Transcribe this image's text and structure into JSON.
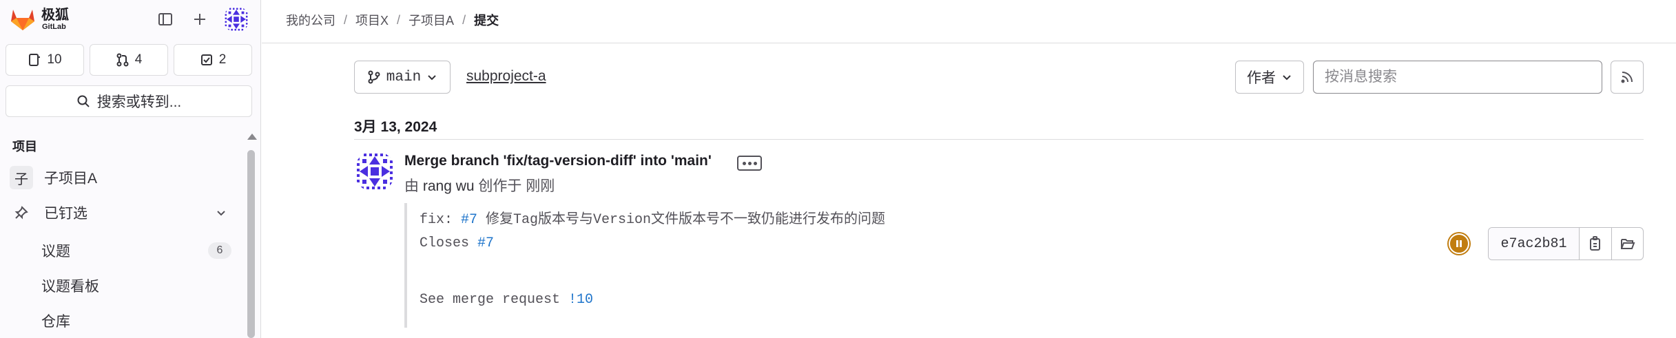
{
  "sidebar": {
    "brand_cn": "极狐",
    "brand_en": "GitLab",
    "counts": [
      {
        "icon": "issues-icon",
        "value": "10"
      },
      {
        "icon": "merge-request-icon",
        "value": "4"
      },
      {
        "icon": "todo-icon",
        "value": "2"
      }
    ],
    "search_label": "搜索或转到...",
    "section_label": "项目",
    "project_badge": "子",
    "project_name": "子项目A",
    "pinned_label": "已钉选",
    "items": [
      {
        "label": "议题",
        "count": "6"
      },
      {
        "label": "议题看板"
      },
      {
        "label": "仓库"
      }
    ]
  },
  "breadcrumb": [
    "我的公司",
    "项目X",
    "子项目A",
    "提交"
  ],
  "toolbar": {
    "branch": "main",
    "path": "subproject-a",
    "author_label": "作者",
    "search_placeholder": "按消息搜索"
  },
  "date_header": "3月 13, 2024",
  "commit": {
    "title": "Merge branch 'fix/tag-version-diff' into 'main'",
    "meta_prefix": "由",
    "author": "rang wu",
    "meta_action": "创作于",
    "time": "刚刚",
    "desc_line1_prefix": "fix: ",
    "desc_line1_ref": "#7",
    "desc_line1_rest": " 修复Tag版本号与Version文件版本号不一致仍能进行发布的问题",
    "desc_line2_prefix": "Closes ",
    "desc_line2_ref": "#7",
    "desc_line3_prefix": "See merge request ",
    "desc_line3_ref": "!10",
    "sha": "e7ac2b81",
    "pipeline_status": "paused"
  },
  "colors": {
    "link": "#1f75cb",
    "pipeline_paused": "#c17d10",
    "avatar": "#4b2fe0"
  }
}
